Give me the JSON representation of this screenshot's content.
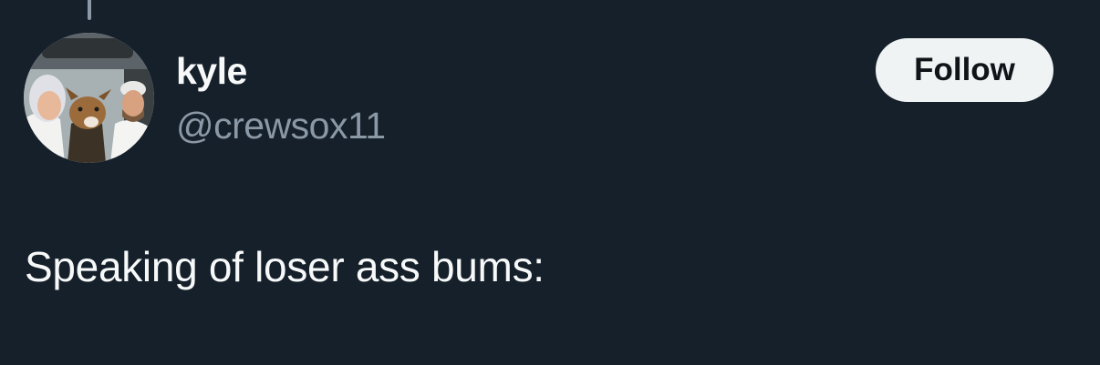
{
  "tweet": {
    "author": {
      "display_name": "kyle",
      "handle": "@crewsox11",
      "avatar_alt": "profile photo"
    },
    "follow_label": "Follow",
    "text": "Speaking of loser ass bums:"
  },
  "colors": {
    "background": "#15202b",
    "primary_text": "#f7f9f9",
    "secondary_text": "#8b98a5",
    "follow_button_bg": "#eff3f4",
    "follow_button_text": "#0f1419"
  }
}
